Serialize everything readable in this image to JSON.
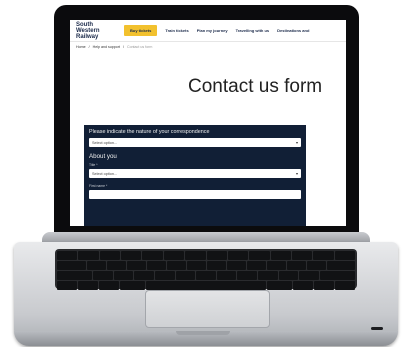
{
  "header": {
    "logo_line1": "South Western",
    "logo_line2": "Railway",
    "buy_button": "Buy tickets",
    "nav": [
      "Train tickets",
      "Plan my journey",
      "Travelling with us",
      "Destinations and"
    ]
  },
  "breadcrumb": {
    "home": "Home",
    "sep1": "/",
    "help": "Help and support",
    "sep2": "/",
    "current": "Contact us form"
  },
  "page_title": "Contact us form",
  "form": {
    "nature_question": "Please indicate the nature of your correspondence",
    "nature_select_value": "Select option...",
    "about_heading": "About you",
    "title_label": "Title *",
    "title_select_value": "Select option...",
    "first_name_label": "First name *",
    "first_name_value": ""
  },
  "colors": {
    "brand_navy": "#111f36",
    "buy_button": "#f2c12e"
  }
}
